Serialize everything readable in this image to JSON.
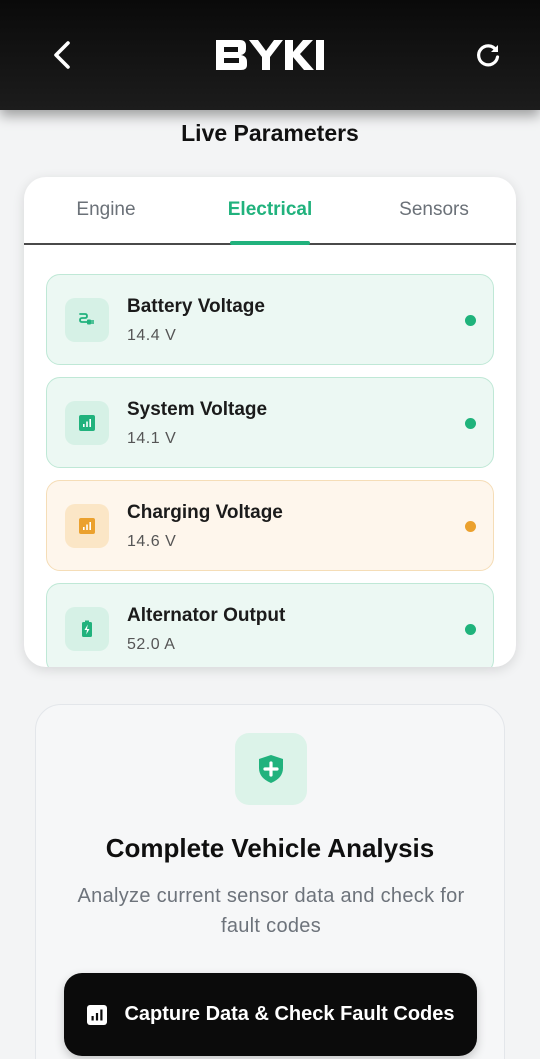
{
  "header": {
    "logo_text": "BYKI",
    "back_icon": "chevron-left-icon",
    "refresh_icon": "refresh-icon"
  },
  "page_title": "Live Parameters",
  "tabs": [
    {
      "label": "Engine",
      "active": false
    },
    {
      "label": "Electrical",
      "active": true
    },
    {
      "label": "Sensors",
      "active": false
    }
  ],
  "parameters": [
    {
      "name": "Battery Voltage",
      "value": "14.4 V",
      "icon": "plug-icon",
      "status": "normal"
    },
    {
      "name": "System Voltage",
      "value": "14.1 V",
      "icon": "bar-chart-icon",
      "status": "normal"
    },
    {
      "name": "Charging Voltage",
      "value": "14.6 V",
      "icon": "bar-chart-icon",
      "status": "warning"
    },
    {
      "name": "Alternator Output",
      "value": "52.0 A",
      "icon": "battery-charging-icon",
      "status": "normal"
    }
  ],
  "analysis": {
    "icon": "shield-plus-icon",
    "title": "Complete Vehicle Analysis",
    "description": "Analyze current sensor data and check for fault codes"
  },
  "cta": {
    "label": "Capture Data & Check Fault Codes",
    "icon": "chart-icon"
  },
  "colors": {
    "accent": "#21b27d",
    "warning": "#eba12e",
    "header_bg": "#111111"
  }
}
